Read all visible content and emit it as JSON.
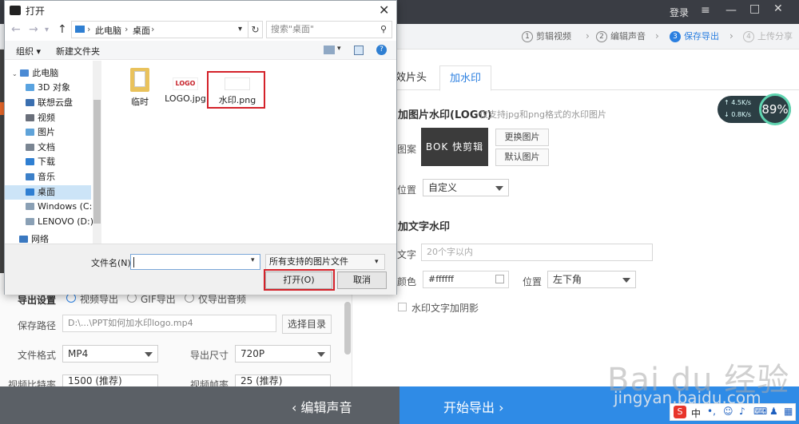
{
  "app": {
    "login": "登录",
    "steps": [
      {
        "num": "1",
        "label": "剪辑视频"
      },
      {
        "num": "2",
        "label": "编辑声音"
      },
      {
        "num": "3",
        "label": "保存导出"
      },
      {
        "num": "4",
        "label": "上传分享"
      }
    ],
    "tabs": [
      "特效片头",
      "加水印"
    ],
    "speed": {
      "up": "4.5K/s",
      "down": "0.8K/s",
      "percent": "89%"
    },
    "watermark": {
      "logo_title": "加图片水印(LOGO)",
      "logo_hint": "仅支持jpg和png格式的水印图片",
      "pattern_label": "图案",
      "logo_preview_text": "BOK 快剪辑",
      "change_image": "更换图片",
      "default_image": "默认图片",
      "position_label": "位置",
      "position_value": "自定义",
      "text_title": "加文字水印",
      "text_label": "文字",
      "text_placeholder": "20个字以内",
      "color_label": "颜色",
      "color_value": "#ffffff",
      "text_position_label": "位置",
      "text_position_value": "左下角",
      "shadow_label": "水印文字加阴影"
    },
    "export": {
      "settings_label": "导出设置",
      "modes": [
        "视频导出",
        "GIF导出",
        "仅导出音频"
      ],
      "path_label": "保存路径",
      "path_value": "D:\\...\\PPT如何加水印logo.mp4",
      "choose_dir": "选择目录",
      "format_label": "文件格式",
      "format_value": "MP4",
      "size_label": "导出尺寸",
      "size_value": "720P",
      "bitrate_label": "视频比特率",
      "bitrate_value": "1500 (推荐)",
      "framerate_label": "视频帧率",
      "framerate_value": "25 (推荐)"
    },
    "bottom": {
      "back": "编辑声音",
      "next": "开始导出"
    },
    "watermark_brand": "Bai du 经验",
    "watermark_url": "jingyan.baidu.com",
    "tray": "中"
  },
  "dialog": {
    "title": "打开",
    "breadcrumb": [
      "此电脑",
      "桌面"
    ],
    "search_placeholder": "搜索\"桌面\"",
    "toolbar": {
      "organize": "组织 ▾",
      "new_folder": "新建文件夹"
    },
    "nav": [
      {
        "label": "此电脑",
        "icon": "computer-icon",
        "color": "#4a8ad4"
      },
      {
        "label": "3D 对象",
        "icon": "cube-icon",
        "color": "#59a3e0"
      },
      {
        "label": "联想云盘",
        "icon": "cloud-icon",
        "color": "#3a6fb0"
      },
      {
        "label": "视频",
        "icon": "video-icon",
        "color": "#6a6f7a"
      },
      {
        "label": "图片",
        "icon": "picture-icon",
        "color": "#5fa3d9"
      },
      {
        "label": "文档",
        "icon": "document-icon",
        "color": "#7a8592"
      },
      {
        "label": "下载",
        "icon": "download-icon",
        "color": "#2f7fd2"
      },
      {
        "label": "音乐",
        "icon": "music-icon",
        "color": "#3c80c9"
      },
      {
        "label": "桌面",
        "icon": "desktop-icon",
        "color": "#2f7fd2"
      },
      {
        "label": "Windows (C:)",
        "icon": "drive-icon",
        "color": "#8aa0b5"
      },
      {
        "label": "LENOVO (D:)",
        "icon": "drive-icon",
        "color": "#8aa0b5"
      },
      {
        "label": "网络",
        "icon": "network-icon",
        "color": "#3a78c0"
      }
    ],
    "files": [
      {
        "name": "临时",
        "type": "folder"
      },
      {
        "name": "LOGO.jpg",
        "type": "image",
        "thumb_text": "LOGO"
      },
      {
        "name": "水印.png",
        "type": "image"
      }
    ],
    "filename_label": "文件名(N):",
    "filename_value": "",
    "filetype_value": "所有支持的图片文件",
    "open_button": "打开(O)",
    "cancel_button": "取消"
  }
}
